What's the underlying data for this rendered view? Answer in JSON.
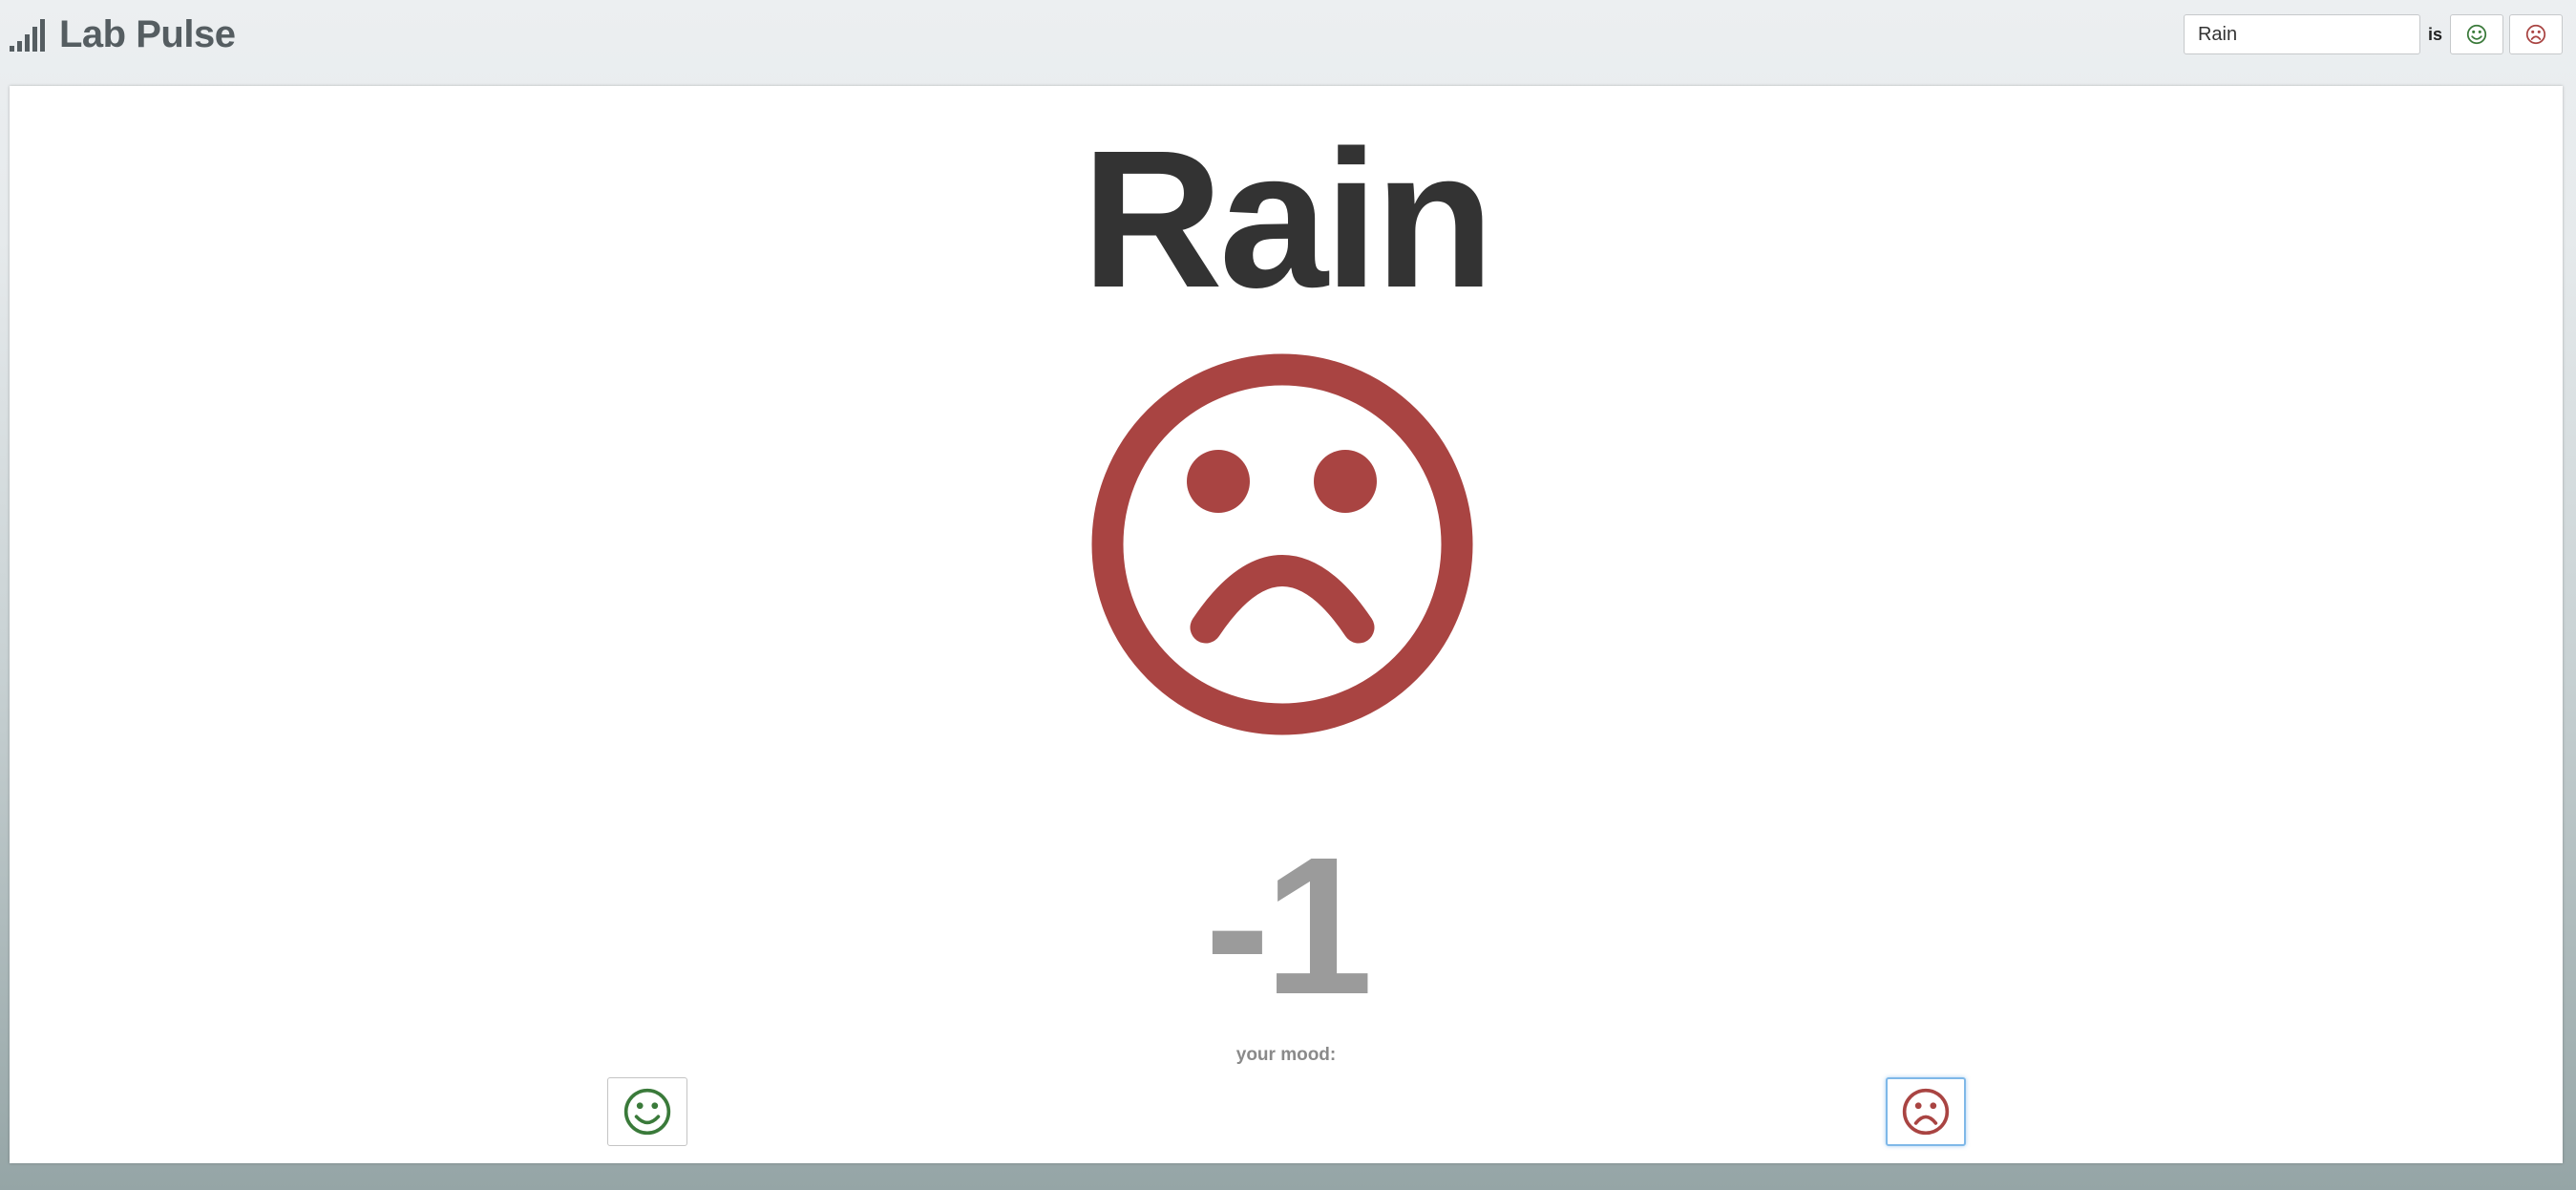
{
  "app": {
    "title": "Lab Pulse",
    "logo_icon": "signal-bars-icon"
  },
  "topic_form": {
    "input_value": "Rain",
    "is_label": "is",
    "happy_icon": "smiley-face-icon",
    "sad_icon": "frowning-face-icon"
  },
  "topic": {
    "title": "Rain",
    "mood_icon": "frowning-face-icon",
    "score": "-1"
  },
  "vote": {
    "label": "your mood:",
    "happy_icon": "smiley-face-icon",
    "sad_icon": "frowning-face-icon",
    "selected": "sad"
  },
  "colors": {
    "happy": "#3a7a3a",
    "sad": "#a94442",
    "title": "#333333",
    "score": "#9b9b9b",
    "brand": "#555d61"
  }
}
